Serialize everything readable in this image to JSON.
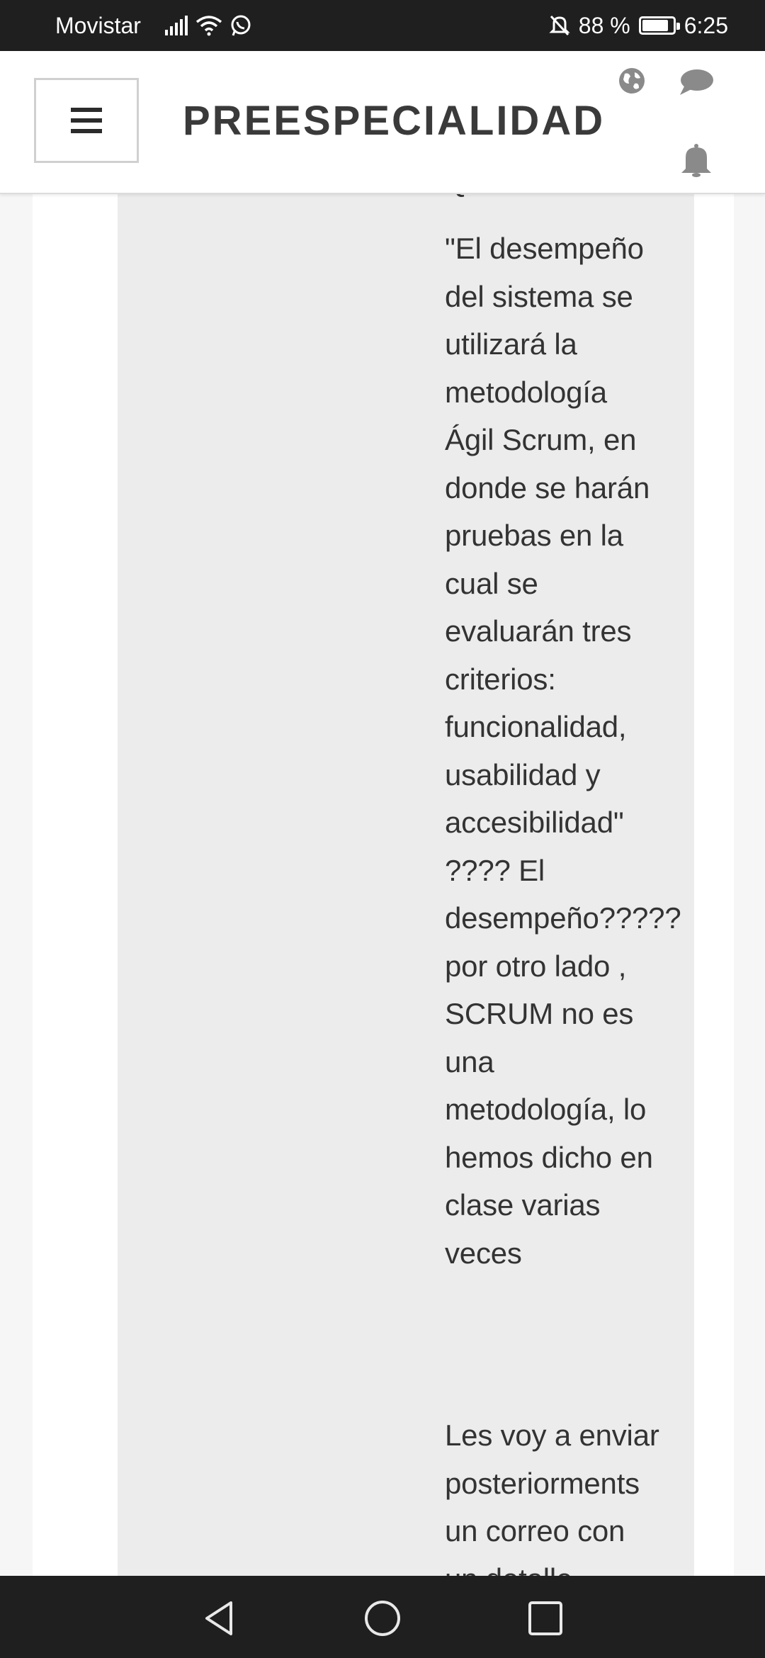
{
  "status_bar": {
    "carrier": "Movistar",
    "battery": "88 %",
    "battery_level": 0.88,
    "time": "6:25"
  },
  "header": {
    "title": "PREESPECIALIDAD",
    "menu_icon": "hamburger-icon",
    "icons": [
      "globe-icon",
      "chat-bubble-icon",
      "bell-icon"
    ]
  },
  "message": {
    "clipped_previous_line": "QUEDAMOS???",
    "paragraph_1": "\"El desempeño\ndel sistema se\nutilizará la\nmetodología\nÁgil Scrum, en\ndonde se harán\npruebas en la\ncual se\nevaluarán tres\ncriterios:\nfuncionalidad,\nusabilidad y\naccesibilidad\"\n????   El\ndesempeño?????\npor otro lado ,\nSCRUM no es\nuna\nmetodología, lo\nhemos dicho en\nclase varias\nveces",
    "paragraph_2": "Les voy a enviar\nposteriorments\nun correo con\nun detalle"
  },
  "nav_bar": {
    "buttons": [
      "back-icon",
      "home-icon",
      "recents-icon"
    ]
  }
}
